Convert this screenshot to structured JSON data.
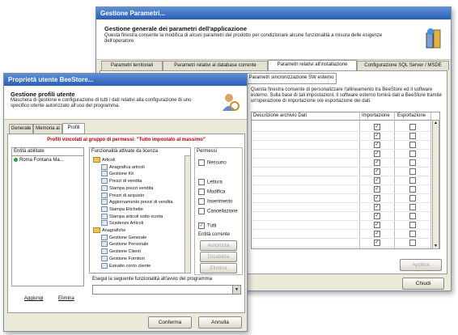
{
  "back_window": {
    "title": "Gestione Parametri...",
    "header_title": "Gestione generale dei parametri dell'applicazione",
    "header_desc": "Questa finestra consente la modifica di alcuni parametri del prodotto per condizionare alcune funzionalità a misura delle esigenze dell'operatore.",
    "tabs": [
      "Parametri territoriali",
      "Parametri relativi al database corrente",
      "Parametri relativi all'installazione",
      "Configurazione SQL Server / MSDE"
    ],
    "subtab": "Parametri sincronizzazione SW esterno",
    "info_text": "Questa finestra consente di personalizzare l'allineamento tra BeeStore ed il software esterno. Sulla base di tali impostazioni, il software esterno fornirà dati a BeeStore tramite un'operazione di importazione o/e esportazione dei dati.",
    "col_entity": "Descrizione archivio Dati",
    "col_import": "Importazione",
    "col_export": "Esportazione",
    "rows": [
      {
        "import": true,
        "export": false
      },
      {
        "import": true,
        "export": false
      },
      {
        "import": true,
        "export": false
      },
      {
        "import": true,
        "export": false
      },
      {
        "import": true,
        "export": false
      },
      {
        "import": true,
        "export": false
      },
      {
        "import": true,
        "export": false
      },
      {
        "import": true,
        "export": false
      },
      {
        "import": true,
        "export": false
      },
      {
        "import": true,
        "export": false
      },
      {
        "import": true,
        "export": false
      },
      {
        "import": true,
        "export": false
      },
      {
        "import": true,
        "export": false
      },
      {
        "import": true,
        "export": false
      }
    ],
    "btn_apply": "Applica",
    "btn_close": "Chiudi"
  },
  "front_window": {
    "title": "Proprietà utente BeeStore...",
    "header_title": "Gestione profili utente",
    "header_desc": "Maschera di gestione e configurazione di tutti i dati relativi alla configurazione di uno specifico utente autorizzato all'uso del programma.",
    "tabs": [
      "Generale",
      "Memoria ai",
      "Profili"
    ],
    "profile_warning": "Profili vincolati al gruppo di permessi: \"Tutto impostato al massimo\"",
    "entity_header": "Entità abilitate",
    "entity_item": "Roma Fontana Ma...",
    "func_header": "Funzionalità attivate da licenza",
    "tree": [
      {
        "label": "Articoli",
        "folder": true
      },
      {
        "label": "Anagrafica articoli",
        "folder": false
      },
      {
        "label": "Gestione Kit",
        "folder": false
      },
      {
        "label": "Prezzi di vendita",
        "folder": false
      },
      {
        "label": "Stampa prezzi vendita",
        "folder": false
      },
      {
        "label": "Prezzi di acquisto",
        "folder": false
      },
      {
        "label": "Aggiornamento prezzi di vendita",
        "folder": false
      },
      {
        "label": "Stampa Etichette",
        "folder": false
      },
      {
        "label": "Stampa articoli sotto scorta",
        "folder": false
      },
      {
        "label": "Scadenze Articoli",
        "folder": false
      },
      {
        "label": "Anagrafiche",
        "folder": true
      },
      {
        "label": "Gestione Generale",
        "folder": false
      },
      {
        "label": "Gestione Personale",
        "folder": false
      },
      {
        "label": "Gestione Clienti",
        "folder": false
      },
      {
        "label": "Gestione Fornitori",
        "folder": false
      },
      {
        "label": "Estratto conto cliente",
        "folder": false
      }
    ],
    "perm_header": "Permessi",
    "perms": [
      {
        "label": "Nessuno",
        "checked": false
      },
      {
        "label": "Lettura",
        "checked": false
      },
      {
        "label": "Modifica",
        "checked": false
      },
      {
        "label": "Inserimento",
        "checked": false
      },
      {
        "label": "Cancellazione",
        "checked": false
      },
      {
        "label": "Tutti",
        "checked": true
      }
    ],
    "entity_correnti": "Entità corrente",
    "btn_autorizza": "Autorizza",
    "btn_disabilita": "Disabilita",
    "btn_elimina_small": "Elimina",
    "assign_label": "Esegui la seguente funzionalità all'avvio del programma",
    "btn_aggiungi": "Aggiungi",
    "btn_elimina": "Elimina",
    "btn_conferma": "Conferma",
    "btn_annulla": "Annulla"
  }
}
